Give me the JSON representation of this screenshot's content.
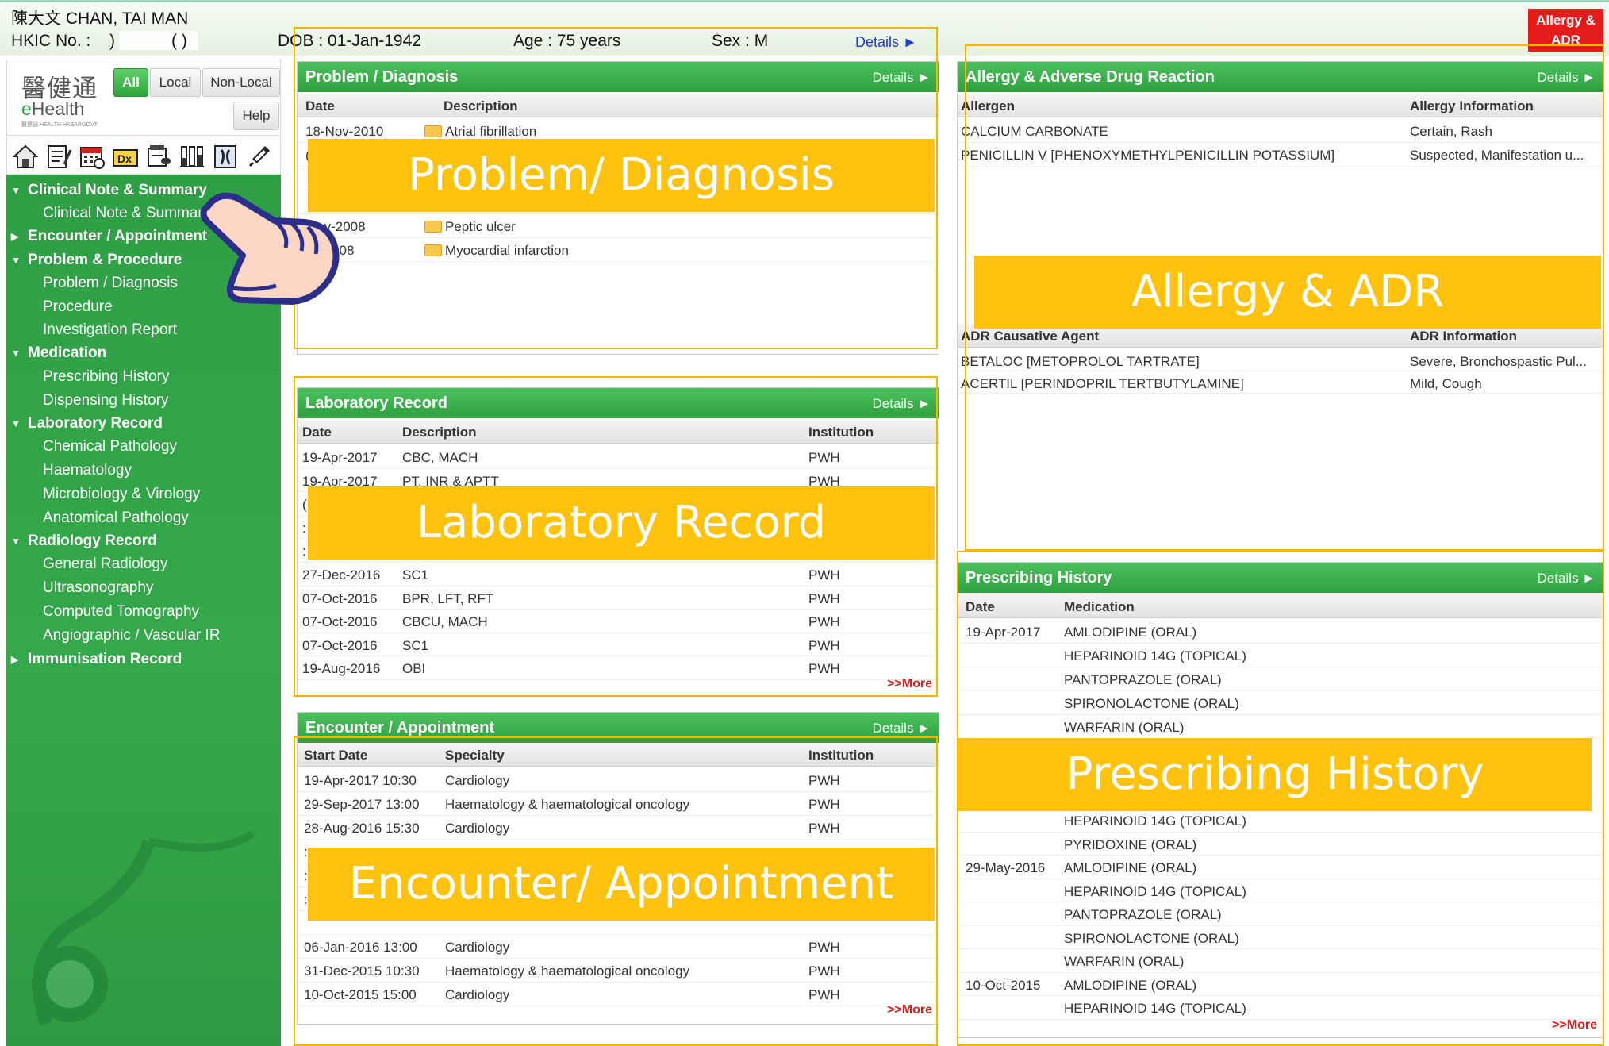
{
  "header": {
    "patient_name": "陳大文  CHAN, TAI MAN",
    "hkic_label": "HKIC No. :",
    "hkic_value": ")",
    "hkic_tail": "( )",
    "dob": "DOB : 01-Jan-1942",
    "age": "Age : 75  years",
    "sex": "Sex : M",
    "details": "Details ►",
    "allergy_line1": "Allergy &",
    "allergy_line2": "ADR"
  },
  "brand": {
    "logo_cn": "醫健通",
    "logo_en_e": "e",
    "logo_en_rest": "Health",
    "logo_sub": "醫健通 HEALTH HKSARGOVT",
    "scope": [
      "All",
      "Local",
      "Non-Local"
    ],
    "help": "Help"
  },
  "toolbar_icons": [
    "home-icon",
    "notes-icon",
    "calendar-icon",
    "dx-icon",
    "medication-icon",
    "laboratory-icon",
    "radiology-icon",
    "immunisation-icon"
  ],
  "nav": [
    {
      "label": "Clinical Note & Summary",
      "kind": "cat",
      "open": true
    },
    {
      "label": "Clinical Note & Summary",
      "kind": "sub"
    },
    {
      "label": "Encounter / Appointment",
      "kind": "cat",
      "open": false
    },
    {
      "label": "Problem & Procedure",
      "kind": "cat",
      "open": true
    },
    {
      "label": "Problem / Diagnosis",
      "kind": "sub"
    },
    {
      "label": "Procedure",
      "kind": "sub"
    },
    {
      "label": "Investigation Report",
      "kind": "sub"
    },
    {
      "label": "Medication",
      "kind": "cat",
      "open": true
    },
    {
      "label": "Prescribing History",
      "kind": "sub"
    },
    {
      "label": "Dispensing History",
      "kind": "sub"
    },
    {
      "label": "Laboratory Record",
      "kind": "cat",
      "open": true
    },
    {
      "label": "Chemical Pathology",
      "kind": "sub"
    },
    {
      "label": "Haematology",
      "kind": "sub"
    },
    {
      "label": "Microbiology & Virology",
      "kind": "sub"
    },
    {
      "label": "Anatomical Pathology",
      "kind": "sub"
    },
    {
      "label": "Radiology Record",
      "kind": "cat",
      "open": true
    },
    {
      "label": "General Radiology",
      "kind": "sub"
    },
    {
      "label": "Ultrasonography",
      "kind": "sub"
    },
    {
      "label": "Computed Tomography",
      "kind": "sub"
    },
    {
      "label": "Angiographic / Vascular IR",
      "kind": "sub"
    },
    {
      "label": "Immunisation Record",
      "kind": "cat",
      "open": false
    }
  ],
  "problem": {
    "title": "Problem / Diagnosis",
    "details": "Details ►",
    "columns": [
      "Date",
      "Description"
    ],
    "rows": [
      [
        "18-Nov-2010",
        "Atrial fibrillation"
      ],
      [
        "(",
        ""
      ],
      [
        "",
        ""
      ],
      [
        "",
        ""
      ],
      [
        "May-2008",
        "Peptic ulcer"
      ],
      [
        "ay-2008",
        "Myocardial infarction"
      ]
    ],
    "banner": "Problem/ Diagnosis"
  },
  "lab": {
    "title": "Laboratory Record",
    "details": "Details ►",
    "columns": [
      "Date",
      "Description",
      "Institution"
    ],
    "rows": [
      [
        "19-Apr-2017",
        "CBC, MACH",
        "PWH"
      ],
      [
        "19-Apr-2017",
        "PT, INR & APTT",
        "PWH"
      ],
      [
        "(",
        "",
        ""
      ],
      [
        ":",
        "",
        ""
      ],
      [
        ":",
        "",
        ""
      ],
      [
        "27-Dec-2016",
        "SC1",
        "PWH"
      ],
      [
        "07-Oct-2016",
        "BPR, LFT, RFT",
        "PWH"
      ],
      [
        "07-Oct-2016",
        "CBCU, MACH",
        "PWH"
      ],
      [
        "07-Oct-2016",
        "SC1",
        "PWH"
      ],
      [
        "19-Aug-2016",
        "OBI",
        "PWH"
      ]
    ],
    "more": ">>More",
    "banner": "Laboratory Record"
  },
  "encounter": {
    "title": "Encounter / Appointment",
    "details": "Details ►",
    "columns": [
      "Start Date",
      "Specialty",
      "Institution"
    ],
    "rows": [
      [
        "19-Apr-2017 10:30",
        "Cardiology",
        "PWH"
      ],
      [
        "29-Sep-2017 13:00",
        "Haematology & haematological oncology",
        "PWH"
      ],
      [
        "28-Aug-2016 15:30",
        "Cardiology",
        "PWH"
      ],
      [
        ":",
        "",
        ""
      ],
      [
        ":",
        "",
        ""
      ],
      [
        ":",
        "",
        ""
      ],
      [
        "",
        "",
        ""
      ],
      [
        "06-Jan-2016 13:00",
        "Cardiology",
        "PWH"
      ],
      [
        "31-Dec-2015 10:30",
        "Haematology & haematological oncology",
        "PWH"
      ],
      [
        "10-Oct-2015 15:00",
        "Cardiology",
        "PWH"
      ]
    ],
    "more": ">>More",
    "banner": "Encounter/ Appointment"
  },
  "allergy": {
    "title": "Allergy & Adverse Drug Reaction",
    "details": "Details ►",
    "columns": [
      "Allergen",
      "Allergy Information"
    ],
    "rows": [
      [
        "CALCIUM CARBONATE",
        "Certain, Rash"
      ],
      [
        "PENICILLIN V [PHENOXYMETHYLPENICILLIN POTASSIUM]",
        "Suspected, Manifestation u..."
      ]
    ],
    "adr_columns": [
      "ADR Causative Agent",
      "ADR Information"
    ],
    "adr_rows": [
      [
        "BETALOC [METOPROLOL TARTRATE]",
        "Severe, Bronchospastic Pul..."
      ],
      [
        "ACERTIL [PERINDOPRIL TERTBUTYLAMINE]",
        "Mild, Cough"
      ]
    ],
    "banner": "Allergy & ADR"
  },
  "prescribing": {
    "title": "Prescribing History",
    "details": "Details ►",
    "columns": [
      "Date",
      "Medication"
    ],
    "rows_top": [
      [
        "19-Apr-2017",
        "AMLODIPINE (ORAL)"
      ],
      [
        "",
        "HEPARINOID 14G (TOPICAL)"
      ],
      [
        "",
        "PANTOPRAZOLE (ORAL)"
      ],
      [
        "",
        "SPIRONOLACTONE (ORAL)"
      ],
      [
        "",
        "WARFARIN (ORAL)"
      ]
    ],
    "rows_bottom": [
      [
        "",
        "HEPARINOID 14G (TOPICAL)"
      ],
      [
        "",
        "PYRIDOXINE (ORAL)"
      ],
      [
        "29-May-2016",
        "AMLODIPINE (ORAL)"
      ],
      [
        "",
        "HEPARINOID 14G (TOPICAL)"
      ],
      [
        "",
        "PANTOPRAZOLE (ORAL)"
      ],
      [
        "",
        "SPIRONOLACTONE (ORAL)"
      ],
      [
        "",
        "WARFARIN (ORAL)"
      ],
      [
        "10-Oct-2015",
        "AMLODIPINE (ORAL)"
      ],
      [
        "",
        "HEPARINOID 14G (TOPICAL)"
      ]
    ],
    "more": ">>More",
    "banner": "Prescribing History"
  },
  "colors": {
    "accent_green": "#35a84b",
    "alert_red": "#e31b1b",
    "annotation_yellow": "#ffc20e",
    "more_red": "#e21d1d"
  }
}
